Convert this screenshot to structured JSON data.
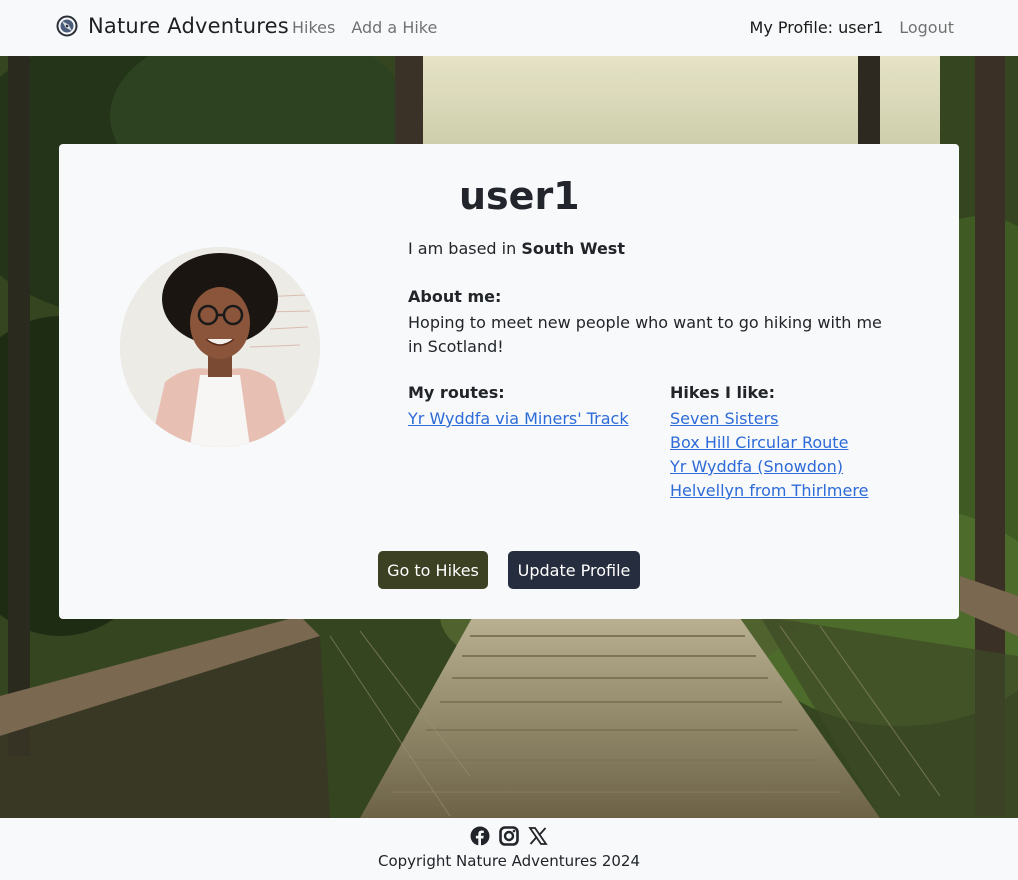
{
  "nav": {
    "brand": "Nature Adventures",
    "links": [
      "Hikes",
      "Add a Hike"
    ],
    "profile_link": "My Profile: user1",
    "logout": "Logout"
  },
  "profile": {
    "username": "user1",
    "based_prefix": "I am based in",
    "region": "South West",
    "about_heading": "About me:",
    "about_text": "Hoping to meet new people who want to go hiking with me in Scotland!",
    "routes_heading": "My routes:",
    "routes": [
      "Yr Wyddfa via Miners' Track"
    ],
    "likes_heading": "Hikes I like:",
    "likes": [
      "Seven Sisters",
      "Box Hill Circular Route",
      "Yr Wyddfa (Snowdon)",
      "Helvellyn from Thirlmere"
    ],
    "go_hikes_button": "Go to Hikes",
    "update_button": "Update Profile"
  },
  "footer": {
    "icons": [
      "facebook-icon",
      "instagram-icon",
      "x-icon"
    ],
    "copyright": "Copyright Nature Adventures 2024"
  },
  "colors": {
    "link": "#2d6bd8",
    "go_hikes_bg": "#3b4122",
    "update_bg": "#262d3e"
  }
}
